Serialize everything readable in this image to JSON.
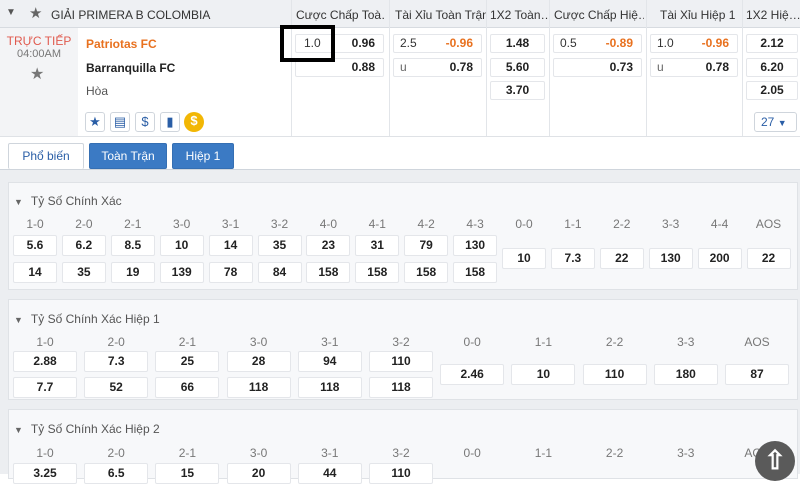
{
  "league": "GIẢI PRIMERA B COLOMBIA",
  "columns": [
    "Cược Chấp Toà…",
    "Tài Xỉu Toàn Trận",
    "1X2 Toàn…",
    "Cược Chấp Hiệ…",
    "Tài Xỉu Hiệp 1",
    "1X2 Hiệ…"
  ],
  "match": {
    "status": "TRỰC TIẾP",
    "time": "04:00AM",
    "home": "Patriotas FC",
    "away": "Barranquilla FC",
    "draw": "Hòa",
    "ft_hdp": {
      "line": "1.0",
      "home": "0.96",
      "away": "0.88"
    },
    "ft_ou": {
      "line": "2.5",
      "over": "-0.96",
      "u": "u",
      "under": "0.78"
    },
    "ft_1x2": {
      "home": "1.48",
      "away": "5.60",
      "draw": "3.70"
    },
    "h1_hdp": {
      "line": "0.5",
      "home": "-0.89",
      "away": "0.73"
    },
    "h1_ou": {
      "line": "1.0",
      "over": "-0.96",
      "u": "u",
      "under": "0.78"
    },
    "h1_1x2": {
      "home": "2.12",
      "away": "6.20",
      "draw": "2.05"
    },
    "more_count": "27"
  },
  "tabs": [
    "Phổ biến",
    "Toàn Trận",
    "Hiệp 1"
  ],
  "sections": [
    {
      "title": "Tỷ Số Chính Xác",
      "labels": [
        "1-0",
        "2-0",
        "2-1",
        "3-0",
        "3-1",
        "3-2",
        "4-0",
        "4-1",
        "4-2",
        "4-3",
        "0-0",
        "1-1",
        "2-2",
        "3-3",
        "4-4",
        "AOS"
      ],
      "home": [
        "5.6",
        "6.2",
        "8.5",
        "10",
        "14",
        "35",
        "23",
        "31",
        "79",
        "130"
      ],
      "away": [
        "14",
        "35",
        "19",
        "139",
        "78",
        "84",
        "158",
        "158",
        "158",
        "158"
      ],
      "draws": [
        "10",
        "7.3",
        "22",
        "130",
        "200",
        "22"
      ]
    },
    {
      "title": "Tỷ Số Chính Xác Hiệp 1",
      "labels": [
        "1-0",
        "2-0",
        "2-1",
        "3-0",
        "3-1",
        "3-2",
        "0-0",
        "1-1",
        "2-2",
        "3-3",
        "AOS"
      ],
      "home": [
        "2.88",
        "7.3",
        "25",
        "28",
        "94",
        "110"
      ],
      "away": [
        "7.7",
        "52",
        "66",
        "118",
        "118",
        "118"
      ],
      "draws": [
        "2.46",
        "10",
        "110",
        "180",
        "87"
      ]
    },
    {
      "title": "Tỷ Số Chính Xác Hiệp 2",
      "labels": [
        "1-0",
        "2-0",
        "2-1",
        "3-0",
        "3-1",
        "3-2",
        "0-0",
        "1-1",
        "2-2",
        "3-3",
        "AOS"
      ],
      "home": [
        "3.25",
        "6.5",
        "15",
        "20",
        "44",
        "110"
      ]
    }
  ]
}
